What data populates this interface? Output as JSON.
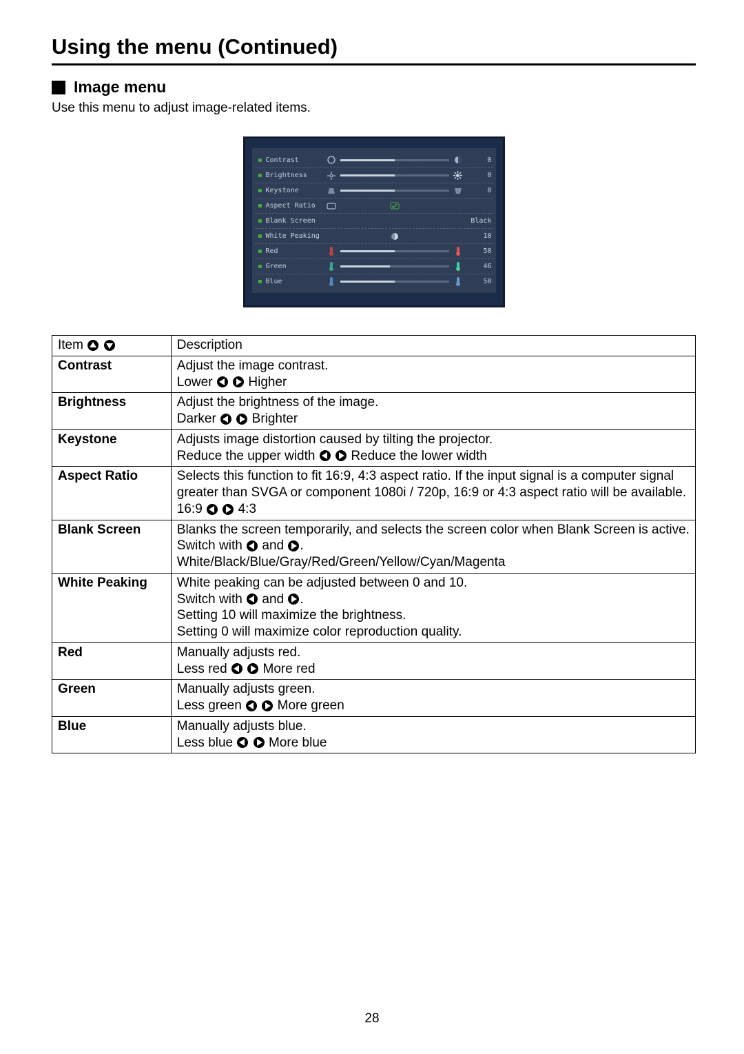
{
  "page_title": "Using the menu (Continued)",
  "section_title": "Image menu",
  "intro": "Use this menu to adjust image-related items.",
  "page_number": "28",
  "osd": {
    "rows": [
      {
        "label": "Contrast",
        "value": "0",
        "fill": 50
      },
      {
        "label": "Brightness",
        "value": "0",
        "fill": 50
      },
      {
        "label": "Keystone",
        "value": "0",
        "fill": 50
      },
      {
        "label": "Aspect Ratio",
        "value": "",
        "fill": 40
      },
      {
        "label": "Blank Screen",
        "value": "Black",
        "fill": null
      },
      {
        "label": "White Peaking",
        "value": "10",
        "fill": 50
      },
      {
        "label": "Red",
        "value": "50",
        "fill": 50
      },
      {
        "label": "Green",
        "value": "46",
        "fill": 46
      },
      {
        "label": "Blue",
        "value": "50",
        "fill": 50
      }
    ]
  },
  "table": {
    "header_item": "Item",
    "header_desc": "Description",
    "rows": {
      "contrast": {
        "name": "Contrast",
        "l1": "Adjust the image contrast.",
        "left": "Lower",
        "right": "Higher"
      },
      "brightness": {
        "name": "Brightness",
        "l1": "Adjust the brightness of the image.",
        "left": "Darker",
        "right": "Brighter"
      },
      "keystone": {
        "name": "Keystone",
        "l1": "Adjusts image distortion caused by tilting the projector.",
        "left": "Reduce the upper width",
        "right": "Reduce the lower width"
      },
      "aspect": {
        "name": "Aspect Ratio",
        "l1": "Selects this function to fit 16:9, 4:3 aspect ratio. If the input signal is a computer signal greater than SVGA or component 1080i / 720p, 16:9 or 4:3 aspect ratio will be available.",
        "left": "16:9",
        "right": "4:3"
      },
      "blank": {
        "name": "Blank Screen",
        "l1": "Blanks the screen temporarily, and selects the screen color when Blank Screen is active.",
        "sw_a": "Switch with",
        "sw_b": "and",
        "sw_c": ".",
        "opts": "White/Black/Blue/Gray/Red/Green/Yellow/Cyan/Magenta"
      },
      "wp": {
        "name": "White Peaking",
        "l1": "White peaking can be adjusted between 0 and 10.",
        "sw_a": "Switch with",
        "sw_b": "and",
        "sw_c": ".",
        "l3": "Setting 10 will maximize the brightness.",
        "l4": "Setting 0 will maximize color reproduction quality."
      },
      "red": {
        "name": "Red",
        "l1": "Manually adjusts red.",
        "left": "Less red",
        "right": "More red"
      },
      "green": {
        "name": "Green",
        "l1": "Manually adjusts green.",
        "left": "Less green",
        "right": "More green"
      },
      "blue": {
        "name": "Blue",
        "l1": "Manually adjusts blue.",
        "left": "Less blue",
        "right": "More blue"
      }
    }
  }
}
